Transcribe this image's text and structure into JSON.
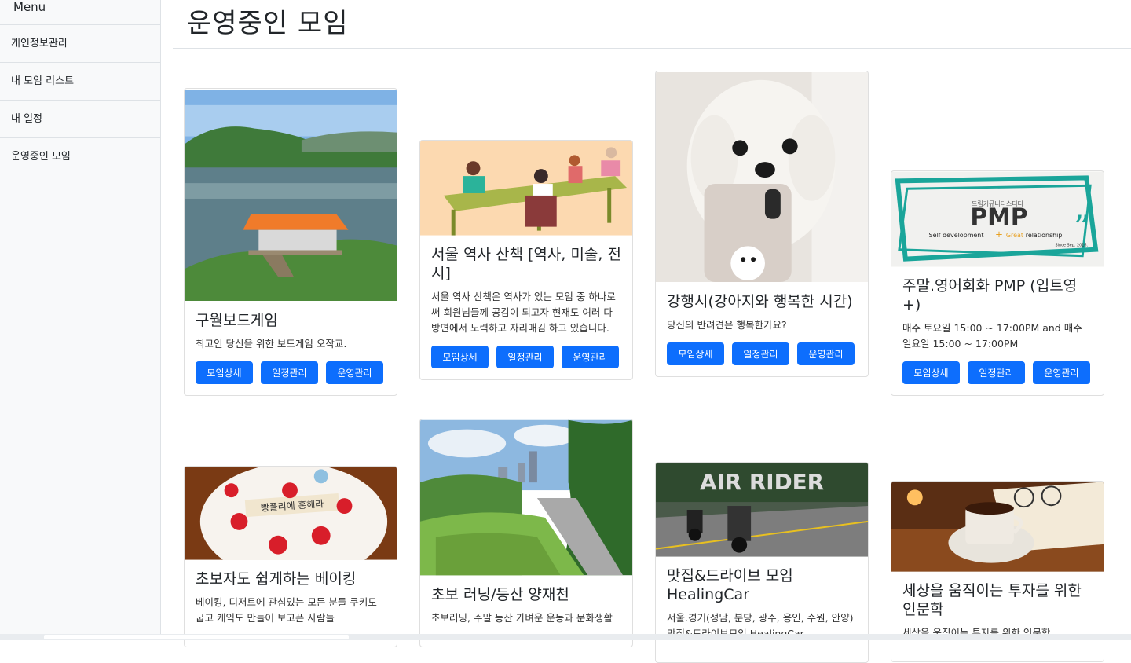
{
  "sidebar": {
    "header": "Menu",
    "items": [
      {
        "label": "개인정보관리"
      },
      {
        "label": "내 모임 리스트"
      },
      {
        "label": "내 일정"
      },
      {
        "label": "운영중인 모임"
      }
    ]
  },
  "page": {
    "title": "운영중인 모임"
  },
  "buttons": {
    "detail": "모임상세",
    "schedule": "일정관리",
    "manage": "운영관리"
  },
  "cards": [
    {
      "title": "구월보드게임",
      "text": "최고인 당신을 위한 보드게임 오작교."
    },
    {
      "title": "서울 역사 산책 [역사, 미술, 전시]",
      "text": "서울 역사 산책은 역사가 있는 모임 중 하나로써 회원님들께 공감이 되고자 현재도 여러 다방면에서 노력하고 자리매김 하고 있습니다."
    },
    {
      "title": "강행시(강아지와 행복한 시간)",
      "text": "당신의 반려견은 행복한가요?",
      "image_text": "",
      "image": "white-puppy-photo"
    },
    {
      "title": "주말.영어회화 PMP (입트영+)",
      "text": "매주 토요일 15:00 ~ 17:00PM and 매주 일요일 15:00 ~ 17:00PM",
      "image_text": {
        "small": "드림커뮤니티스터디",
        "big": "PMP",
        "line": "Self development",
        "plus": "+",
        "great": "Great",
        "rel": "relationship",
        "since": "Since Sep. 2016."
      }
    },
    {
      "title": "초보자도 쉽게하는 베이킹",
      "text": "베이킹, 디저트에 관심있는 모든 분들 쿠키도 굽고 케익도 만들어 보고픈 사람들",
      "image_text": "빵플리에 홍해라"
    },
    {
      "title": "초보 러닝/등산 양재천",
      "text": "초보러닝, 주말 등산 가벼운 운동과 문화생활"
    },
    {
      "title": "맛집&드라이브 모임 HealingCar",
      "text": "서울.경기(성남, 분당, 광주, 용인, 수원, 안양) 맛집&드라이브모임 HealingCar",
      "image_text": "AIR RIDER"
    },
    {
      "title": "세상을 움직이는 투자를 위한 인문학",
      "text": "세상을 움직이는 투자를 위한 인문학"
    }
  ],
  "colors": {
    "primary": "#0d6efd",
    "sidebar_bg": "#f8f9fa"
  }
}
